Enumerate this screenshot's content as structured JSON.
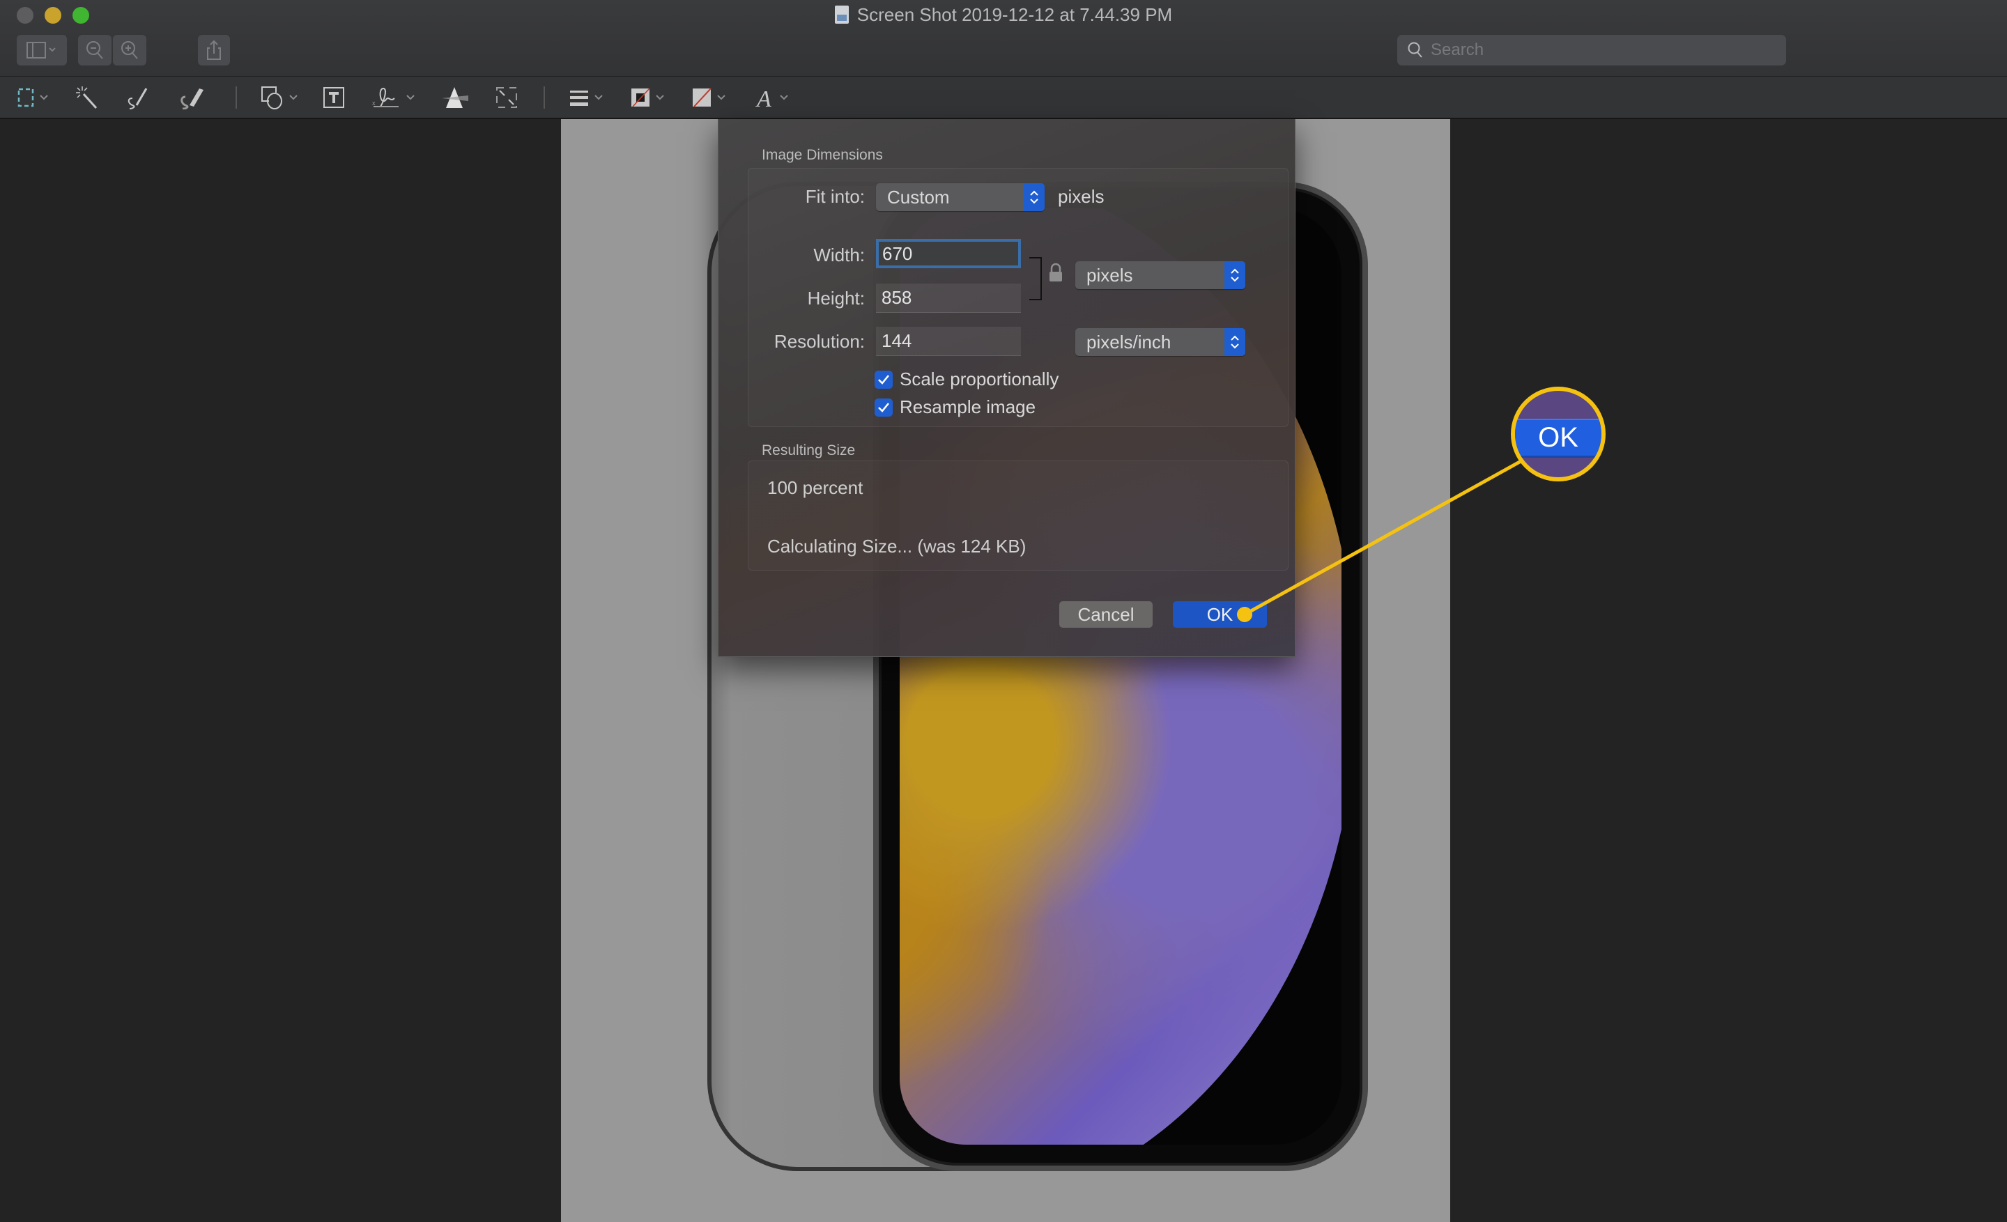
{
  "window": {
    "title": "Screen Shot 2019-12-12 at 7.44.39 PM",
    "traffic_lights": [
      "close",
      "minimize",
      "zoom"
    ]
  },
  "toolbar": {
    "left_buttons": [
      {
        "name": "sidebar-toggle",
        "icon": "sidebar-icon"
      },
      {
        "name": "zoom-out",
        "icon": "zoom-out-icon"
      },
      {
        "name": "zoom-in",
        "icon": "zoom-in-icon"
      },
      {
        "name": "share",
        "icon": "share-icon"
      }
    ],
    "right_buttons": [
      {
        "name": "markup-pen",
        "icon": "pen-icon"
      },
      {
        "name": "rotate",
        "icon": "rotate-icon"
      },
      {
        "name": "markup-toggle",
        "icon": "markup-circle-a-icon"
      }
    ],
    "search_placeholder": "Search",
    "search_value": ""
  },
  "markup_tools": [
    {
      "name": "selection-tool",
      "icon": "dashed-rect-icon",
      "has_menu": true
    },
    {
      "name": "instant-alpha",
      "icon": "magic-wand-icon"
    },
    {
      "name": "sketch",
      "icon": "sketch-pen-icon"
    },
    {
      "name": "draw",
      "icon": "draw-brush-icon"
    },
    {
      "name": "shapes",
      "icon": "shapes-icon",
      "has_menu": true
    },
    {
      "name": "text",
      "icon": "text-box-icon"
    },
    {
      "name": "sign",
      "icon": "signature-icon",
      "has_menu": true
    },
    {
      "name": "adjust-color",
      "icon": "prism-icon"
    },
    {
      "name": "adjust-size",
      "icon": "resize-icon"
    },
    {
      "name": "shape-style",
      "icon": "lines-icon",
      "has_menu": true
    },
    {
      "name": "border-color",
      "icon": "border-color-icon",
      "has_menu": true
    },
    {
      "name": "fill-color",
      "icon": "fill-color-icon",
      "has_menu": true
    },
    {
      "name": "text-style",
      "icon": "font-a-icon",
      "has_menu": true
    }
  ],
  "dialog": {
    "image_dimensions_label": "Image Dimensions",
    "fit_into": {
      "label": "Fit into:",
      "value": "Custom",
      "unit": "pixels"
    },
    "width": {
      "label": "Width:",
      "value": "670"
    },
    "height": {
      "label": "Height:",
      "value": "858"
    },
    "resolution": {
      "label": "Resolution:",
      "value": "144"
    },
    "size_unit": "pixels",
    "resolution_unit": "pixels/inch",
    "scale_proportionally": {
      "label": "Scale proportionally",
      "checked": true
    },
    "resample_image": {
      "label": "Resample image",
      "checked": true
    },
    "resulting_size_label": "Resulting Size",
    "percent": "100 percent",
    "size_status": "Calculating Size... (was 124 KB)",
    "cancel_label": "Cancel",
    "ok_label": "OK"
  },
  "annotation": {
    "callout_label": "OK",
    "highlight_color": "#f5c211"
  },
  "colors": {
    "accent_blue": "#1d56c4",
    "window_bg": "#232323",
    "callout_yellow": "#f5c211"
  }
}
